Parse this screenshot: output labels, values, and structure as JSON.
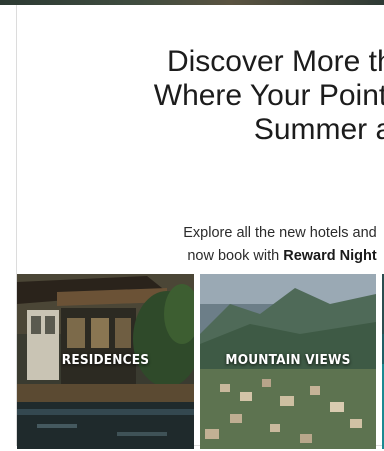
{
  "hero": {
    "headline_lines": [
      "Discover More than",
      "Where Your Points",
      "Summer ar"
    ],
    "subcopy_line1": "Explore all the new hotels and",
    "subcopy_line2_prefix": "now book with ",
    "subcopy_line2_bold": "Reward Night"
  },
  "tiles": [
    {
      "label": "RESIDENCES",
      "image": "residence-villa-photo"
    },
    {
      "label": "MOUNTAIN VIEWS",
      "image": "mountain-town-photo"
    },
    {
      "label": "",
      "image": "teal-water-photo"
    }
  ],
  "colors": {
    "headline": "#1c1c1c",
    "body": "#2b2b2b",
    "border": "#dcdcdc"
  }
}
